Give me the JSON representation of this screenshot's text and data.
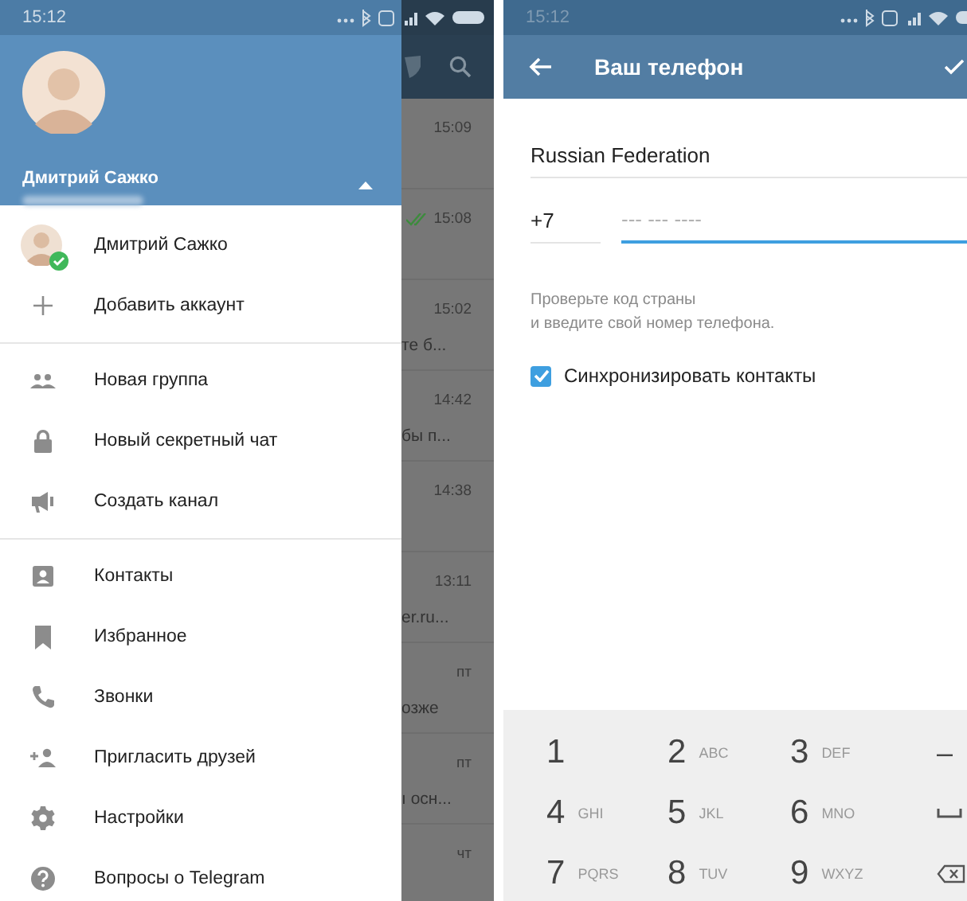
{
  "left_screen": {
    "status_bar": {
      "time": "15:12"
    },
    "drawer": {
      "header": {
        "name": "Дмитрий Сажко",
        "expanded": true
      },
      "accounts": [
        {
          "name": "Дмитрий Сажко",
          "selected": true
        }
      ],
      "add_account": "Добавить аккаунт",
      "sections": [
        [
          "Новая группа",
          "Новый секретный чат",
          "Создать канал"
        ],
        [
          "Контакты",
          "Избранное",
          "Звонки",
          "Пригласить друзей",
          "Настройки",
          "Вопросы о Telegram"
        ]
      ]
    },
    "chat_list": [
      {
        "time": "15:09",
        "read": false
      },
      {
        "time": "15:08",
        "read": true
      },
      {
        "time": "15:02",
        "preview": "те б...",
        "read": false
      },
      {
        "time": "14:42",
        "preview": "бы п...",
        "read": false
      },
      {
        "time": "14:38",
        "read": false
      },
      {
        "time": "13:11",
        "preview": "er.ru...",
        "read": false
      },
      {
        "time": "пт",
        "preview": "озже",
        "read": false
      },
      {
        "time": "пт",
        "preview": "ı осн...",
        "read": false
      },
      {
        "time": "чт",
        "read": false
      }
    ]
  },
  "right_screen": {
    "status_bar": {
      "time": "15:12"
    },
    "title": "Ваш телефон",
    "country": "Russian Federation",
    "code": "+7",
    "phone_placeholder": "--- --- ----",
    "hint": "Проверьте код страны\nи введите свой номер телефона.",
    "sync_contacts": {
      "label": "Синхронизировать контакты",
      "checked": true
    },
    "keypad": [
      {
        "kind": "digit",
        "digit": "1"
      },
      {
        "kind": "digit",
        "digit": "2",
        "letters": "ABC"
      },
      {
        "kind": "digit",
        "digit": "3",
        "letters": "DEF"
      },
      {
        "kind": "symbol",
        "digit": "–"
      },
      {
        "kind": "digit",
        "digit": "4",
        "letters": "GHI"
      },
      {
        "kind": "digit",
        "digit": "5",
        "letters": "JKL"
      },
      {
        "kind": "digit",
        "digit": "6",
        "letters": "MNO"
      },
      {
        "kind": "space"
      },
      {
        "kind": "digit",
        "digit": "7",
        "letters": "PQRS"
      },
      {
        "kind": "digit",
        "digit": "8",
        "letters": "TUV"
      },
      {
        "kind": "digit",
        "digit": "9",
        "letters": "WXYZ"
      },
      {
        "kind": "backspace"
      }
    ]
  }
}
